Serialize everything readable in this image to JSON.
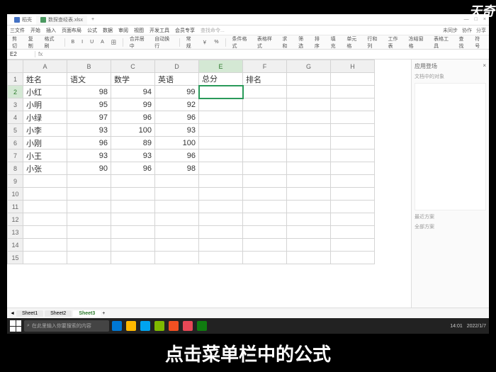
{
  "watermark": "天奇生活",
  "corner": "天奇",
  "caption": "点击菜单栏中的公式",
  "titlebar": {
    "home_tab": "稻壳",
    "doc_tab": "数探查经表.xlsx",
    "close": "×",
    "min": "—",
    "max": "□"
  },
  "menubar": {
    "items": [
      "三文件",
      "开始",
      "插入",
      "页面布局",
      "公式",
      "数据",
      "审阅",
      "视图",
      "开发工具",
      "会员专享"
    ],
    "search_ph": "查找命令...",
    "right": [
      "未同步",
      "协作",
      "分享"
    ]
  },
  "toolbar": {
    "items": [
      "剪切",
      "复制",
      "格式刷",
      "B",
      "I",
      "U",
      "A",
      "田",
      "合并居中",
      "自动换行",
      "常规",
      "￥",
      "%",
      "条件格式",
      "表格样式",
      "求和",
      "筛选",
      "排序",
      "填充",
      "单元格",
      "行和列",
      "工作表",
      "冻结窗格",
      "表格工具",
      "查找",
      "符号"
    ]
  },
  "cellref": {
    "ref": "E2",
    "fx": "fx"
  },
  "columns": [
    "A",
    "B",
    "C",
    "D",
    "E",
    "F",
    "G",
    "H"
  ],
  "headers": {
    "A": "姓名",
    "B": "语文",
    "C": "数学",
    "D": "英语",
    "E": "总分",
    "F": "排名"
  },
  "rows": [
    {
      "n": "小红",
      "c": 98,
      "m": 94,
      "e": 99
    },
    {
      "n": "小明",
      "c": 95,
      "m": 99,
      "e": 92
    },
    {
      "n": "小绿",
      "c": 97,
      "m": 96,
      "e": 96
    },
    {
      "n": "小李",
      "c": 93,
      "m": 100,
      "e": 93
    },
    {
      "n": "小刚",
      "c": 96,
      "m": 89,
      "e": 100
    },
    {
      "n": "小王",
      "c": 93,
      "m": 93,
      "e": 96
    },
    {
      "n": "小张",
      "c": 90,
      "m": 96,
      "e": 98
    }
  ],
  "selected_cell": "E2",
  "side": {
    "title": "应用登场",
    "sub": "文档中的对象",
    "footer1": "最近方案",
    "footer2": "全部方案"
  },
  "sheets": [
    "Sheet1",
    "Sheet2",
    "Sheet3"
  ],
  "active_sheet": 2,
  "statusbar": "在此里输入你要搜索的内容",
  "taskbar": {
    "search": "在此里输入你要搜索的内容",
    "time": "14:01",
    "date": "2022/1/7"
  }
}
